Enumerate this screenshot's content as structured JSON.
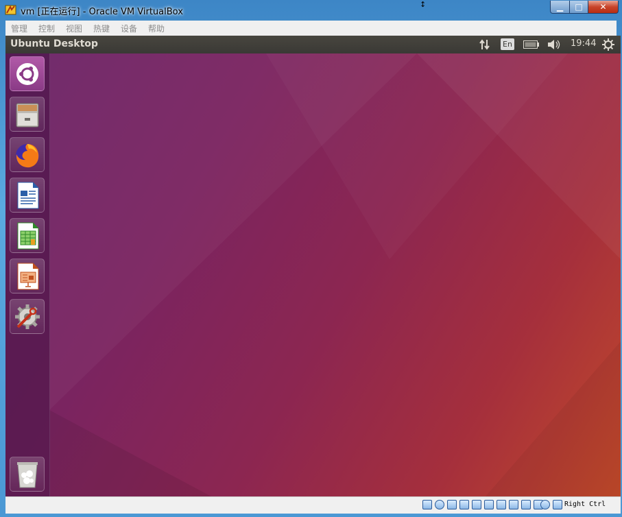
{
  "window": {
    "title": "vm [正在运行] - Oracle VM VirtualBox",
    "controls": {
      "minimize": "▁",
      "maximize": "□",
      "close": "✕"
    }
  },
  "menubar": {
    "items": [
      "管理",
      "控制",
      "视图",
      "热键",
      "设备",
      "帮助"
    ]
  },
  "panel": {
    "title": "Ubuntu Desktop",
    "language": "En",
    "time": "19:44",
    "icons": [
      "network-icon",
      "battery-icon",
      "volume-icon",
      "settings-gear-icon"
    ]
  },
  "launcher": {
    "items": [
      {
        "name": "ubuntu-dash"
      },
      {
        "name": "files"
      },
      {
        "name": "firefox"
      },
      {
        "name": "libreoffice-writer"
      },
      {
        "name": "libreoffice-calc"
      },
      {
        "name": "libreoffice-impress"
      },
      {
        "name": "system-settings"
      },
      {
        "name": "trash"
      }
    ]
  },
  "statusbar": {
    "host_key": "Right Ctrl"
  },
  "colors": {
    "panel": "#3c3b37",
    "desktop_start": "#6b2467",
    "desktop_end": "#c24a2a",
    "ubuntu_orange": "#e95420"
  }
}
